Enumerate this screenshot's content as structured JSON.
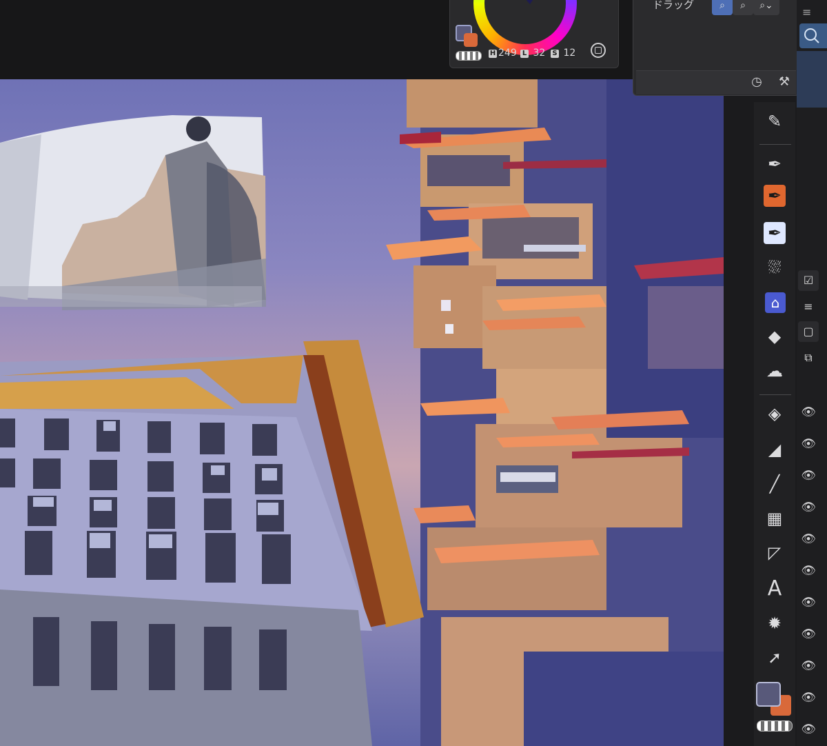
{
  "color_panel": {
    "h_key": "H",
    "h_value": "249",
    "l_key": "L",
    "l_value": "32",
    "s_key": "S",
    "s_value": "12",
    "main_color": "#58597a",
    "sub_color": "#d9693a"
  },
  "tool_property": {
    "drag_label": "ドラッグ",
    "mode_buttons": [
      "zoom-in-mode-icon",
      "zoom-out-mode-icon",
      "zoom-reset-mode-icon"
    ]
  },
  "tools": [
    {
      "name": "eyedropper-tool",
      "glyph": "✎"
    },
    {
      "name": "pen-tool",
      "glyph": "✒"
    },
    {
      "name": "pencil-tool",
      "glyph": "✒"
    },
    {
      "name": "marker-tool",
      "glyph": "✒"
    },
    {
      "name": "airbrush-tool",
      "glyph": "⛆"
    },
    {
      "name": "decoration-tool",
      "glyph": "⌂"
    },
    {
      "name": "eraser-tool",
      "glyph": "◆"
    },
    {
      "name": "blend-tool",
      "glyph": "☁"
    },
    {
      "name": "fill-tool",
      "glyph": "◈"
    },
    {
      "name": "gradient-tool",
      "glyph": "◢"
    },
    {
      "name": "figure-tool",
      "glyph": "╱"
    },
    {
      "name": "frame-border-tool",
      "glyph": "▦"
    },
    {
      "name": "ruler-tool",
      "glyph": "◸"
    },
    {
      "name": "text-tool",
      "glyph": "A"
    },
    {
      "name": "balloon-tool",
      "glyph": "✹"
    },
    {
      "name": "object-tool",
      "glyph": "➚"
    }
  ],
  "colors": {
    "accent_orange": "#e0672f",
    "accent_blue": "#4a5ad0",
    "panel_bg": "#2a2a2c"
  }
}
